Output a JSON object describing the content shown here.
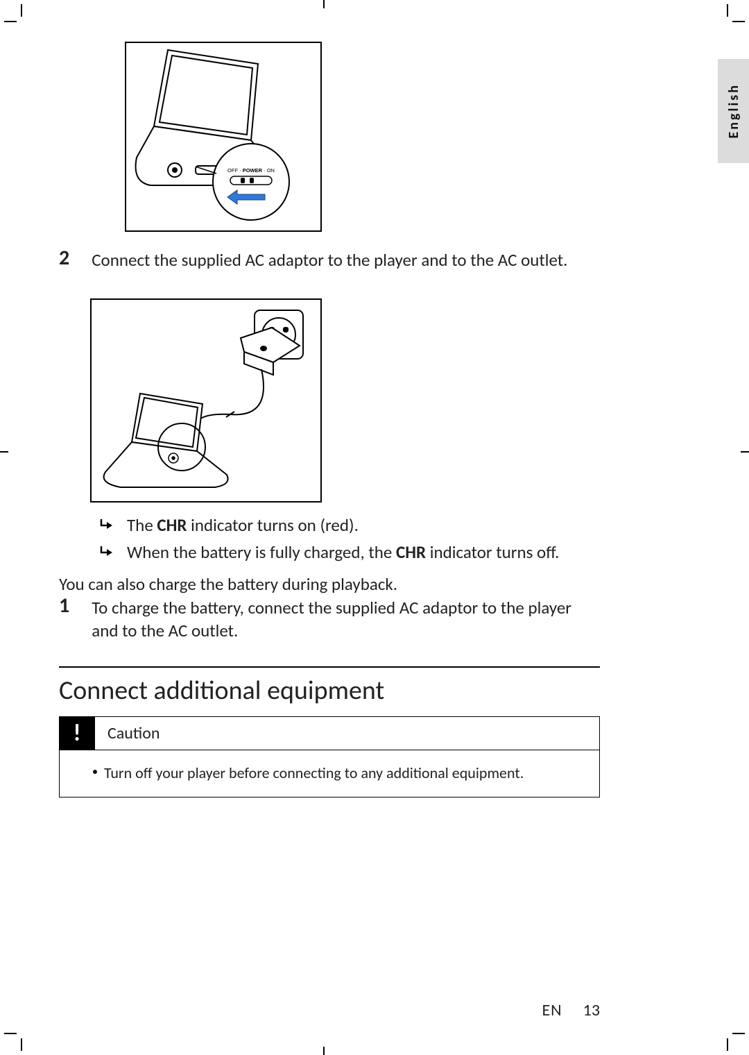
{
  "lang_tab": "English",
  "step2": {
    "num": "2",
    "text": "Connect the supplied AC adaptor to the player and to the AC outlet."
  },
  "illus1_labels": {
    "off": "OFF",
    "power": "POWER",
    "on": "ON"
  },
  "arrow_list": [
    {
      "pre": "The ",
      "bold": "CHR",
      "post": " indicator turns on (red)."
    },
    {
      "pre": "When the battery is fully charged, the ",
      "bold": "CHR",
      "post": " indicator turns off."
    }
  ],
  "subheading": "You can also charge the battery during playback.",
  "step1b": {
    "num": "1",
    "text": "To charge the battery, connect the supplied AC adaptor to the player and to the AC outlet."
  },
  "section_heading": "Connect additional equipment",
  "caution": {
    "label": "Caution",
    "bullet": "Turn off your player before connecting to any additional equipment."
  },
  "footer": {
    "lang": "EN",
    "page": "13"
  }
}
